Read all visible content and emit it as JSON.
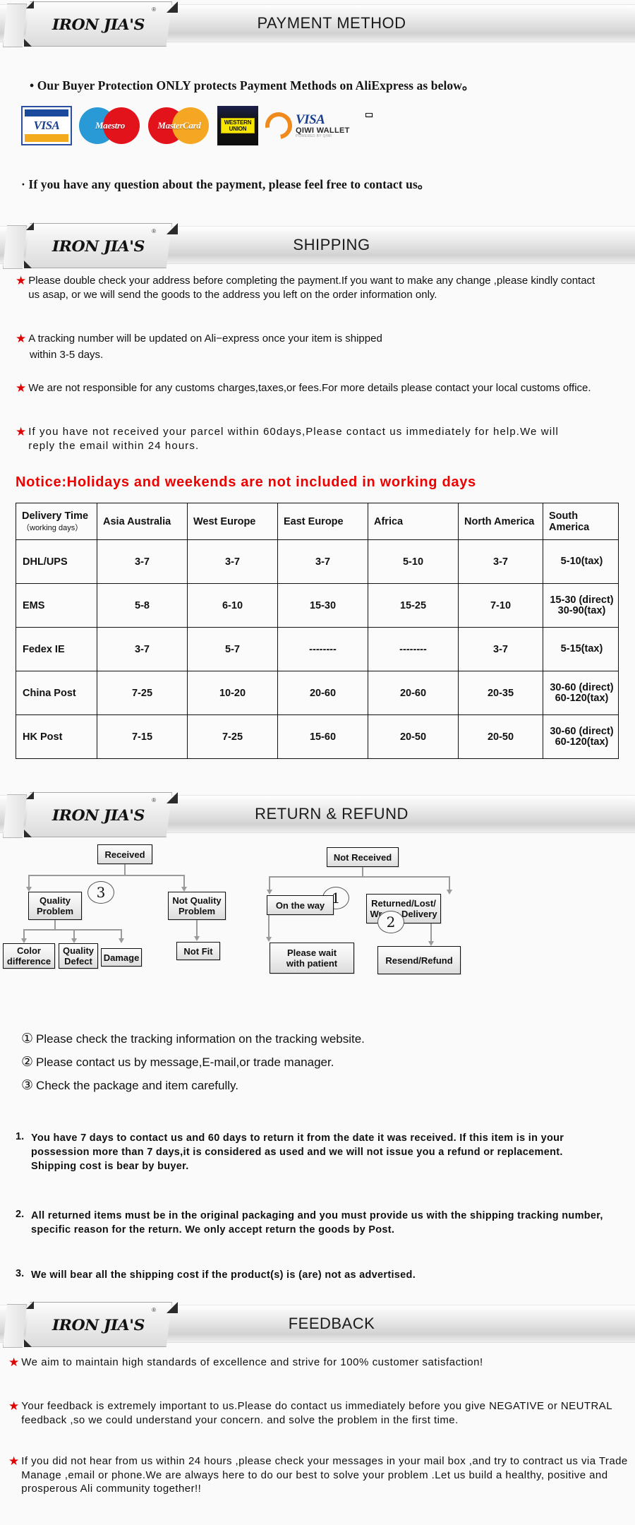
{
  "brand": {
    "name": "IRON JIA'S",
    "registered": "®"
  },
  "sections": {
    "payment": {
      "title": "PAYMENT METHOD",
      "bullet1": "•  Our Buyer Protection ONLY protects Payment Methods on AliExpress as below。",
      "bullet2": "· If you have any question about the payment, please feel free to contact us。",
      "logos": [
        {
          "name": "visa-logo",
          "label": "VISA"
        },
        {
          "name": "maestro-logo",
          "label": "Maestro"
        },
        {
          "name": "mastercard-logo",
          "label": "MasterCard"
        },
        {
          "name": "western-union-logo",
          "label_line1": "WESTERN",
          "label_line2": "UNION"
        },
        {
          "name": "qiwi-wallet-logo",
          "label": "VISA",
          "label2": "QIWI WALLET",
          "label3": "POWERED BY QIWI"
        }
      ]
    },
    "shipping": {
      "title": "SHIPPING",
      "bullets": [
        "Please double check your address before completing the payment.If you want to make any change ,please kindly contact us asap, or we will send the goods to the address you left on the order information only.",
        "A tracking number will be updated on Ali−express once your item is shipped",
        "within 3-5 days.",
        "We are not responsible for any customs charges,taxes,or fees.For more details please contact your local customs office.",
        "If you have not received your parcel within  60days,Please contact us immediately for help.We will reply the email within 24 hours."
      ],
      "notice": "Notice:Holidays and weekends are not included in working days",
      "table": {
        "headers": [
          {
            "main": "Delivery Time",
            "sub": "（working days）"
          },
          {
            "main": "Asia Australia"
          },
          {
            "main": "West Europe"
          },
          {
            "main": "East Europe"
          },
          {
            "main": "Africa"
          },
          {
            "main": "North America"
          },
          {
            "main": "South America"
          }
        ],
        "rows": [
          {
            "method": "DHL/UPS",
            "cells": [
              "3-7",
              "3-7",
              "3-7",
              "5-10",
              "3-7",
              "5-10(tax)"
            ],
            "last_multiline": false
          },
          {
            "method": "EMS",
            "cells": [
              "5-8",
              "6-10",
              "15-30",
              "15-25",
              "7-10",
              "15-30\n(direct)\n30-90(tax)"
            ],
            "last_multiline": true
          },
          {
            "method": "Fedex IE",
            "cells": [
              "3-7",
              "5-7",
              "--------",
              "--------",
              "3-7",
              "5-15(tax)"
            ],
            "last_multiline": false
          },
          {
            "method": "China Post",
            "cells": [
              "7-25",
              "10-20",
              "20-60",
              "20-60",
              "20-35",
              "30-60\n(direct)\n60-120(tax)"
            ],
            "last_multiline": true
          },
          {
            "method": "HK Post",
            "cells": [
              "7-15",
              "7-25",
              "15-60",
              "20-50",
              "20-50",
              "30-60\n(direct)\n60-120(tax)"
            ],
            "last_multiline": true
          }
        ]
      }
    },
    "return": {
      "title": "RETURN & REFUND",
      "flowchart": {
        "nodes": [
          {
            "id": "received",
            "label": "Received"
          },
          {
            "id": "quality",
            "label": "Quality\nProblem"
          },
          {
            "id": "notquality",
            "label": "Not Quality\nProblem"
          },
          {
            "id": "colordiff",
            "label": "Color\ndifference"
          },
          {
            "id": "qualitydefect",
            "label": "Quality\nDefect"
          },
          {
            "id": "damage",
            "label": "Damage"
          },
          {
            "id": "notfit",
            "label": "Not Fit"
          },
          {
            "id": "notreceived",
            "label": "Not  Received"
          },
          {
            "id": "ontheway",
            "label": "On the way"
          },
          {
            "id": "returnedlost",
            "label": "Returned/Lost/\nWrong Delivery"
          },
          {
            "id": "pleasewait",
            "label": "Please wait\nwith patient"
          },
          {
            "id": "resendrefund",
            "label": "Resend/Refund"
          }
        ],
        "markers": [
          {
            "id": "marker-3",
            "label": "3"
          },
          {
            "id": "marker-1",
            "label": "1"
          },
          {
            "id": "marker-2",
            "label": "2"
          }
        ]
      },
      "circle_notes": [
        {
          "num": "①",
          "text": "Please check the tracking information on the tracking website."
        },
        {
          "num": "②",
          "text": "Please contact us by  message,E-mail,or trade manager."
        },
        {
          "num": "③",
          "text": "Check the package and item carefully."
        }
      ],
      "policies": [
        {
          "num": "1.",
          "text": "You have 7 days to contact us and 60 days to return it from the date it was received. If this item is in your possession more than 7 days,it is considered as used and we will not issue you a refund or replacement. Shipping cost is bear by buyer."
        },
        {
          "num": "2.",
          "text": "All returned items must be in the original packaging and you must provide us with the shipping tracking number, specific reason for the return. We only accept return the goods by Post."
        },
        {
          "num": "3.",
          "text": "We will bear all the shipping cost if the product(s) is (are) not as advertised."
        }
      ]
    },
    "feedback": {
      "title": "FEEDBACK",
      "bullets": [
        "We aim to maintain high standards of excellence and strive  for 100% customer satisfaction!",
        "Your feedback is extremely important to us.Please do contact us immediately before you give NEGATIVE or NEUTRAL feedback ,so  we could understand your concern. and solve the problem in the first time.",
        "If you did not hear from us within 24 hours ,please check your messages in your mail box ,and try to contract us via Trade Manage ,email or phone.We are always here to do our best to solve your problem .Let us build a healthy, positive and prosperous Ali community together!!"
      ]
    }
  },
  "colors": {
    "star_red": "#e00000",
    "notice_red": "#ee0000",
    "visa_blue": "#1a3f8f",
    "mastercard_red": "#e3131b",
    "mastercard_orange": "#f5a623",
    "maestro_blue": "#2a9ad6",
    "qiwi_orange": "#f08a1d",
    "wu_yellow": "#f6e500"
  }
}
